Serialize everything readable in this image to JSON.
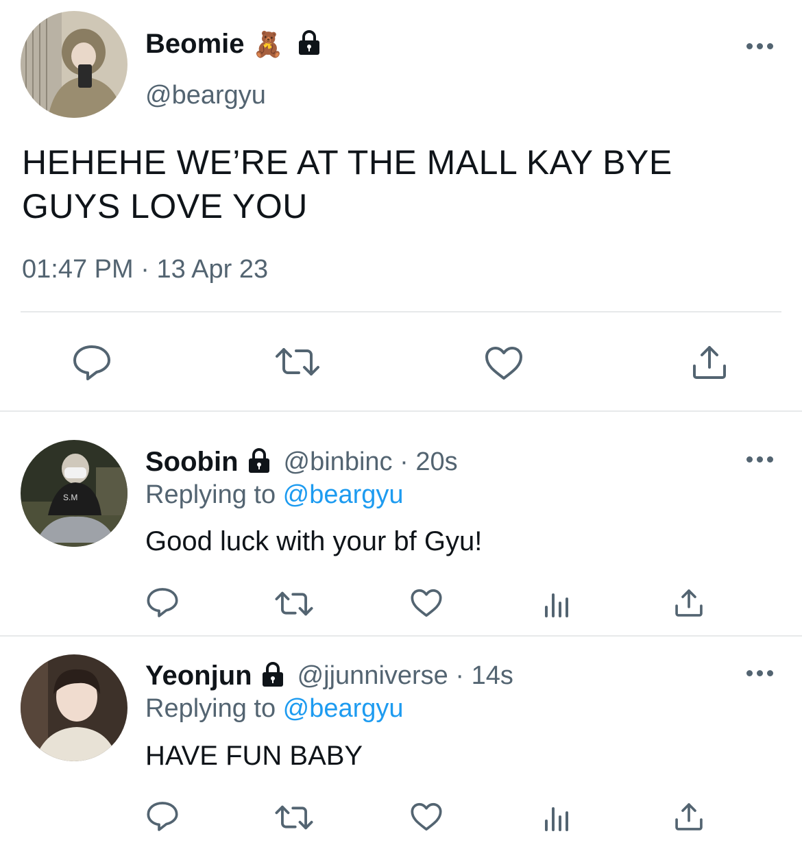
{
  "main_tweet": {
    "name": "Beomie",
    "emoji": "🧸",
    "handle": "@beargyu",
    "text_line1": "HEHEHE WE’RE AT THE MALL KAY BYE",
    "text_line2": "GUYS LOVE YOU",
    "time": "01:47 PM",
    "separator": "·",
    "date": "13 Apr 23"
  },
  "replies": [
    {
      "name": "Soobin",
      "handle": "@binbinc",
      "separator": "·",
      "age": "20s",
      "replying_prefix": "Replying to ",
      "replying_handle": "@beargyu",
      "text": "Good luck with your bf Gyu!"
    },
    {
      "name": "Yeonjun",
      "handle": "@jjunniverse",
      "separator": "·",
      "age": "14s",
      "replying_prefix": "Replying to ",
      "replying_handle": "@beargyu",
      "text": "HAVE FUN BABY"
    }
  ],
  "colors": {
    "text": "#0f1419",
    "muted": "#536471",
    "link": "#1d9bf0",
    "divider": "#e7e9ea"
  },
  "icons": [
    "more-icon",
    "lock-icon",
    "reply-icon",
    "retweet-icon",
    "like-icon",
    "share-icon",
    "analytics-icon"
  ]
}
